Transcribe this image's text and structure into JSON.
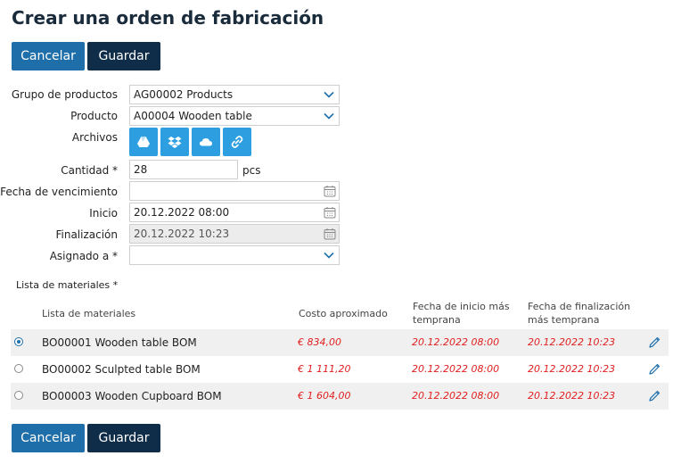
{
  "page": {
    "title": "Crear una orden de fabricación"
  },
  "actions": {
    "cancel_label": "Cancelar",
    "save_label": "Guardar"
  },
  "form": {
    "product_group": {
      "label": "Grupo de productos",
      "value": "AG00002 Products"
    },
    "product": {
      "label": "Producto",
      "value": "A00004 Wooden table"
    },
    "files": {
      "label": "Archivos",
      "buttons": [
        "google-drive-icon",
        "dropbox-icon",
        "cloud-icon",
        "link-icon"
      ]
    },
    "quantity": {
      "label": "Cantidad *",
      "value": "28",
      "unit": "pcs"
    },
    "due_date": {
      "label": "Fecha de vencimiento",
      "value": ""
    },
    "start": {
      "label": "Inicio",
      "value": "20.12.2022 08:00"
    },
    "end": {
      "label": "Finalización",
      "value": "20.12.2022 10:23"
    },
    "assigned": {
      "label": "Asignado a *",
      "value": ""
    }
  },
  "bom": {
    "section_label": "Lista de materiales *",
    "headers": {
      "name": "Lista de materiales",
      "cost": "Costo aproximado",
      "start_l1": "Fecha de inicio más",
      "start_l2": "temprana",
      "end_l1": "Fecha de finalización",
      "end_l2": "más temprana"
    },
    "rows": [
      {
        "selected": true,
        "name": "BO00001 Wooden table BOM",
        "cost": "€ 834,00",
        "start": "20.12.2022 08:00",
        "end": "20.12.2022 10:23"
      },
      {
        "selected": false,
        "name": "BO00002 Sculpted table BOM",
        "cost": "€ 1 111,20",
        "start": "20.12.2022 08:00",
        "end": "20.12.2022 10:23"
      },
      {
        "selected": false,
        "name": "BO00003 Wooden Cupboard BOM",
        "cost": "€ 1 604,00",
        "start": "20.12.2022 08:00",
        "end": "20.12.2022 10:23"
      }
    ]
  },
  "colors": {
    "primary": "#1e6eaa",
    "dark": "#0f2c48",
    "file_button": "#2d9fe0",
    "warning_text": "#e02020"
  }
}
